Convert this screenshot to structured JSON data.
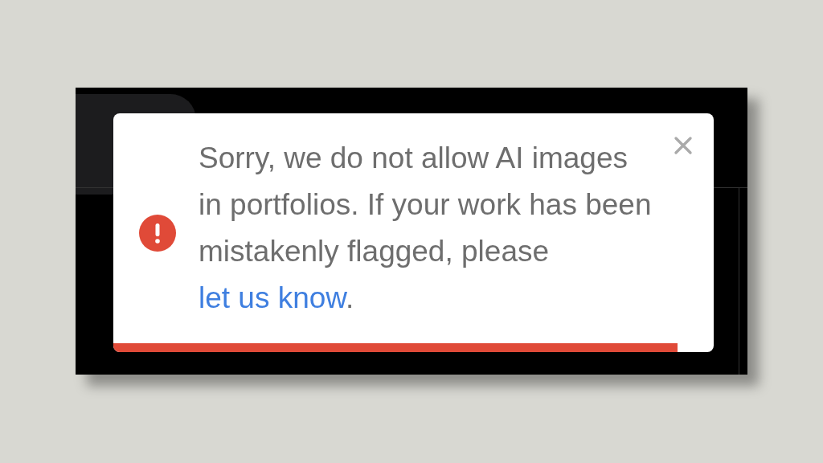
{
  "toast": {
    "message": {
      "text": "Sorry, we do not allow AI images in portfolios. If your work has been mistakenly flagged, please ",
      "link": "let us know",
      "after_link": "."
    },
    "progress": {
      "level": 0.94
    }
  }
}
